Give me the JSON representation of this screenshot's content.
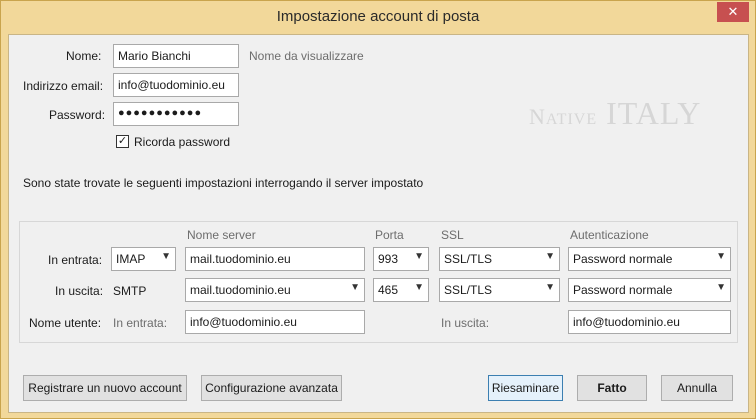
{
  "window": {
    "title": "Impostazione account di posta",
    "close_glyph": "✕"
  },
  "form": {
    "name_label": "Nome:",
    "name_value": "Mario Bianchi",
    "name_hint": "Nome da visualizzare",
    "email_label": "Indirizzo email:",
    "email_value": "info@tuodominio.eu",
    "password_label": "Password:",
    "password_value": "●●●●●●●●●●●",
    "remember_label": "Ricorda password",
    "remember_checked": true,
    "check_glyph": "✓"
  },
  "watermark": {
    "brand": "NativeITALY"
  },
  "status_message": "Sono state trovate le seguenti impostazioni interrogando il server impostato",
  "server_table": {
    "headers": {
      "server": "Nome server",
      "port": "Porta",
      "ssl": "SSL",
      "auth": "Autenticazione"
    },
    "incoming": {
      "label": "In entrata:",
      "protocol": "IMAP",
      "server": "mail.tuodominio.eu",
      "port": "993",
      "ssl": "SSL/TLS",
      "auth": "Password normale"
    },
    "outgoing": {
      "label": "In uscita:",
      "protocol": "SMTP",
      "server": "mail.tuodominio.eu",
      "port": "465",
      "ssl": "SSL/TLS",
      "auth": "Password normale"
    },
    "username": {
      "label": "Nome utente:",
      "incoming_label": "In entrata:",
      "incoming_value": "info@tuodominio.eu",
      "outgoing_label": "In uscita:",
      "outgoing_value": "info@tuodominio.eu"
    }
  },
  "buttons": {
    "new_account": "Registrare un nuovo account",
    "advanced": "Configurazione avanzata",
    "retest": "Riesaminare",
    "done": "Fatto",
    "cancel": "Annulla"
  },
  "icons": {
    "dropdown": "chevron-down-icon",
    "close": "close-icon",
    "check": "checkmark-icon"
  }
}
